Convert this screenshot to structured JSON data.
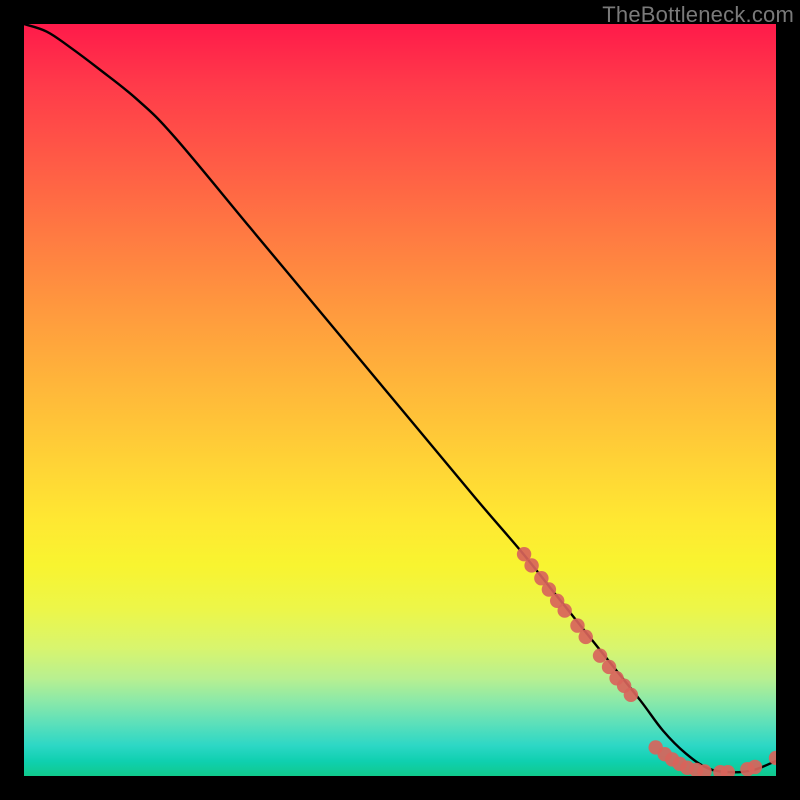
{
  "watermark": "TheBottleneck.com",
  "chart_data": {
    "type": "line",
    "title": "",
    "xlabel": "",
    "ylabel": "",
    "xlim": [
      0,
      100
    ],
    "ylim": [
      0,
      100
    ],
    "grid": false,
    "series": [
      {
        "name": "bottleneck-curve",
        "x": [
          0,
          3,
          6,
          10,
          15,
          20,
          30,
          40,
          50,
          60,
          66,
          70,
          74,
          78,
          82,
          85,
          88,
          91,
          94,
          97,
          100
        ],
        "y": [
          100,
          99,
          97,
          94,
          90,
          85,
          73,
          61,
          49,
          37,
          30,
          25,
          20,
          15,
          10,
          6,
          3,
          1,
          0.5,
          0.8,
          2
        ],
        "color": "#000000"
      }
    ],
    "markers": [
      {
        "series": "cluster-descend",
        "color": "#d8645b",
        "points": [
          {
            "x": 66.5,
            "y": 29.5
          },
          {
            "x": 67.5,
            "y": 28.0
          },
          {
            "x": 68.8,
            "y": 26.3
          },
          {
            "x": 69.8,
            "y": 24.8
          },
          {
            "x": 70.9,
            "y": 23.3
          },
          {
            "x": 71.9,
            "y": 22.0
          },
          {
            "x": 73.6,
            "y": 20.0
          },
          {
            "x": 74.7,
            "y": 18.5
          },
          {
            "x": 76.6,
            "y": 16.0
          },
          {
            "x": 77.8,
            "y": 14.5
          },
          {
            "x": 78.8,
            "y": 13.0
          },
          {
            "x": 79.8,
            "y": 12.0
          },
          {
            "x": 80.7,
            "y": 10.8
          }
        ]
      },
      {
        "series": "cluster-trough",
        "color": "#d8645b",
        "points": [
          {
            "x": 84.0,
            "y": 3.8
          },
          {
            "x": 85.2,
            "y": 2.9
          },
          {
            "x": 86.2,
            "y": 2.2
          },
          {
            "x": 87.2,
            "y": 1.6
          },
          {
            "x": 88.2,
            "y": 1.1
          },
          {
            "x": 89.4,
            "y": 0.8
          },
          {
            "x": 90.5,
            "y": 0.6
          },
          {
            "x": 92.6,
            "y": 0.5
          },
          {
            "x": 93.6,
            "y": 0.5
          },
          {
            "x": 96.2,
            "y": 0.9
          },
          {
            "x": 97.2,
            "y": 1.2
          },
          {
            "x": 100.0,
            "y": 2.4
          }
        ]
      }
    ]
  }
}
